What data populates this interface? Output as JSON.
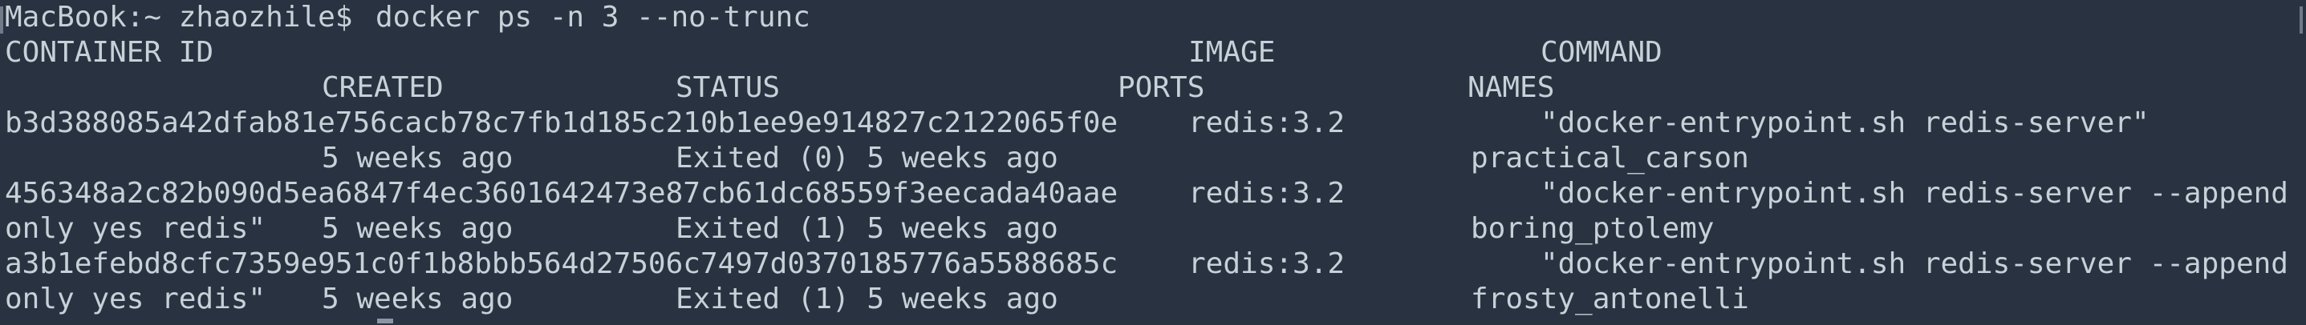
{
  "terminal": {
    "prompt": "MacBook:~ zhaozhile$ ",
    "command": "docker ps -n 3 --no-trunc",
    "header": {
      "container_id": "CONTAINER ID",
      "image": "IMAGE",
      "command": "COMMAND",
      "created": "CREATED",
      "status": "STATUS",
      "ports": "PORTS",
      "names": "NAMES"
    },
    "rows": [
      {
        "container_id": "b3d388085a42dfab81e756cacb78c7fb1d185c210b1ee9e914827c2122065f0e",
        "image": "redis:3.2",
        "command_line1": "\"docker-entrypoint.sh redis-server\"",
        "command_line2": "",
        "created": "5 weeks ago",
        "status": "Exited (0) 5 weeks ago",
        "ports": "",
        "names": "practical_carson"
      },
      {
        "container_id": "456348a2c82b090d5ea6847f4ec3601642473e87cb61dc68559f3eecada40aae",
        "image": "redis:3.2",
        "command_line1": "\"docker-entrypoint.sh redis-server --append",
        "command_line2": "only yes redis\"",
        "created": "5 weeks ago",
        "status": "Exited (1) 5 weeks ago",
        "ports": "",
        "names": "boring_ptolemy"
      },
      {
        "container_id": "a3b1efebd8cfc7359e951c0f1b8bbb564d27506c7497d0370185776a5588685c",
        "image": "redis:3.2",
        "command_line1": "\"docker-entrypoint.sh redis-server --append",
        "command_line2": "only yes redis\"",
        "created": "5 weeks ago",
        "status": "Exited (1) 5 weeks ago",
        "ports": "",
        "names": "frosty_antonelli"
      }
    ]
  }
}
